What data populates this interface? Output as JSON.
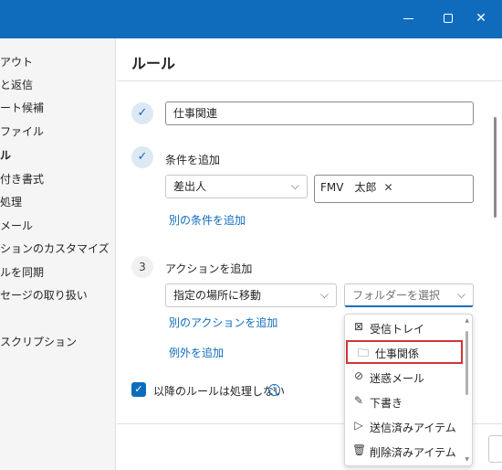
{
  "window": {
    "controls": {
      "minimize": "minimize",
      "maximize": "maximize",
      "close": "✕"
    }
  },
  "sidebar": {
    "items": [
      {
        "label": "アウト"
      },
      {
        "label": "と返信"
      },
      {
        "label": "ート候補"
      },
      {
        "label": "ファイル"
      },
      {
        "label": "ル",
        "active": true
      },
      {
        "label": "付き書式"
      },
      {
        "label": "処理"
      },
      {
        "label": "メール"
      },
      {
        "label": "ションのカスタマイズ"
      },
      {
        "label": "ルを同期"
      },
      {
        "label": "セージの取り扱い"
      },
      {
        "label": "スクリプション"
      }
    ]
  },
  "main": {
    "title": "ルール",
    "rule_name": {
      "value": "仕事関連"
    },
    "conditions": {
      "step_icon": "✓",
      "label": "条件を追加",
      "condition_dropdown": "差出人",
      "sender_chip": "FMV　太郎",
      "chip_remove": "✕",
      "add_condition_link": "別の条件を追加"
    },
    "actions": {
      "step_number": "3",
      "label": "アクションを追加",
      "action_dropdown": "指定の場所に移動",
      "folder_placeholder": "フォルダーを選択",
      "add_action_link": "別のアクションを追加"
    },
    "add_exception_link": "例外を追加",
    "stop_processing": {
      "checked": true,
      "label": "以降のルールは処理しない"
    },
    "name_step_icon": "✓"
  },
  "folder_menu": {
    "items": [
      {
        "label": "受信トレイ",
        "icon": "inbox-icon",
        "glyph": "⊠"
      },
      {
        "label": "仕事関係",
        "icon": "folder-icon",
        "glyph": "🗀",
        "highlighted": true
      },
      {
        "label": "迷惑メール",
        "icon": "junk-folder-icon",
        "glyph": "⊘"
      },
      {
        "label": "下書き",
        "icon": "pencil-icon",
        "glyph": "✎"
      },
      {
        "label": "送信済みアイテム",
        "icon": "send-icon",
        "glyph": "▷"
      },
      {
        "label": "削除済みアイテム",
        "icon": "trash-icon",
        "glyph": "🗑"
      }
    ]
  },
  "colors": {
    "accent": "#0f6cbd",
    "highlight_border": "#d13438"
  }
}
